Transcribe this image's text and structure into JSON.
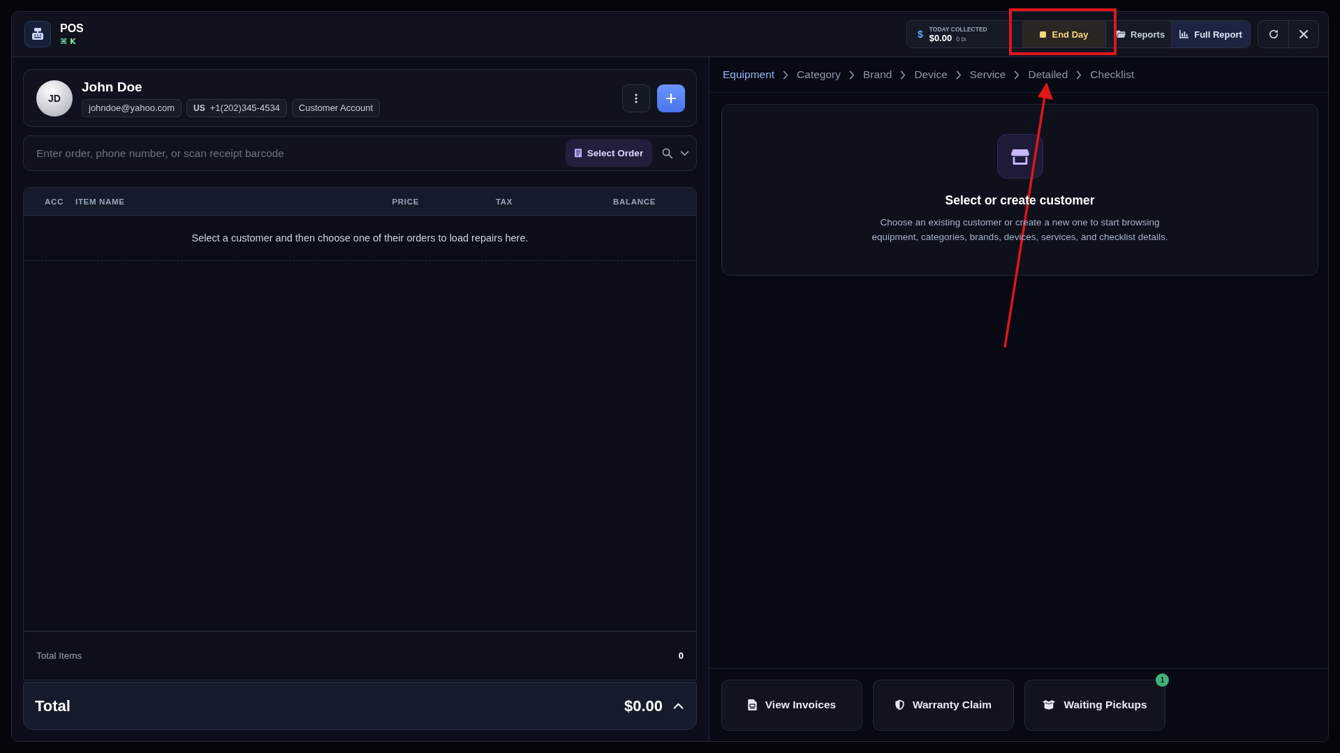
{
  "app": {
    "title": "POS",
    "shortcut": "⌘ K"
  },
  "collected": {
    "symbol": "$",
    "label": "TODAY COLLECTED",
    "amount": "$0.00",
    "count": "0 tx"
  },
  "toolbar": [
    {
      "kind": "stop",
      "label": "End Day"
    },
    {
      "kind": "folder",
      "label": "Reports"
    },
    {
      "kind": "chart",
      "label": "Full Report"
    }
  ],
  "window_controls": [
    {
      "kind": "refresh"
    },
    {
      "kind": "close"
    }
  ],
  "customer": {
    "initials": "JD",
    "name": "John Doe",
    "tags": [
      {
        "kind": "email",
        "text": "johndoe@yahoo.com"
      },
      {
        "kind": "phone",
        "country": "US",
        "text": "+1(202)345-4534"
      },
      {
        "kind": "account",
        "text": "Customer Account"
      }
    ]
  },
  "order_search": {
    "placeholder": "Enter order, phone number, or scan receipt barcode",
    "button": "Select Order"
  },
  "table": {
    "columns": [
      "ACC",
      "ITEM NAME",
      "PRICE",
      "TAX",
      "BALANCE"
    ],
    "empty_message": "Select a customer and then choose one of their orders to load repairs here."
  },
  "summary": {
    "items_label": "Total Items",
    "items_count": "0",
    "total_label": "Total",
    "total": "$0.00"
  },
  "breadcrumb": [
    {
      "label": "Equipment",
      "selected": true
    },
    {
      "label": "Category",
      "selected": false
    },
    {
      "label": "Brand",
      "selected": false
    },
    {
      "label": "Device",
      "selected": false
    },
    {
      "label": "Service",
      "selected": false
    },
    {
      "label": "Detailed",
      "selected": false
    },
    {
      "label": "Checklist",
      "selected": false
    }
  ],
  "empty_state": {
    "title": "Select or create customer",
    "text": "Choose an existing customer or create a new one to start browsing equipment, categories, brands, devices, services, and checklist details."
  },
  "actions": [
    {
      "kind": "invoices",
      "label": "View Invoices"
    },
    {
      "kind": "warranty",
      "label": "Warranty Claim"
    },
    {
      "kind": "pickups",
      "label": "Waiting Pickups",
      "badge": "1"
    }
  ],
  "markup": {
    "highlight_box": true,
    "arrow": true
  }
}
